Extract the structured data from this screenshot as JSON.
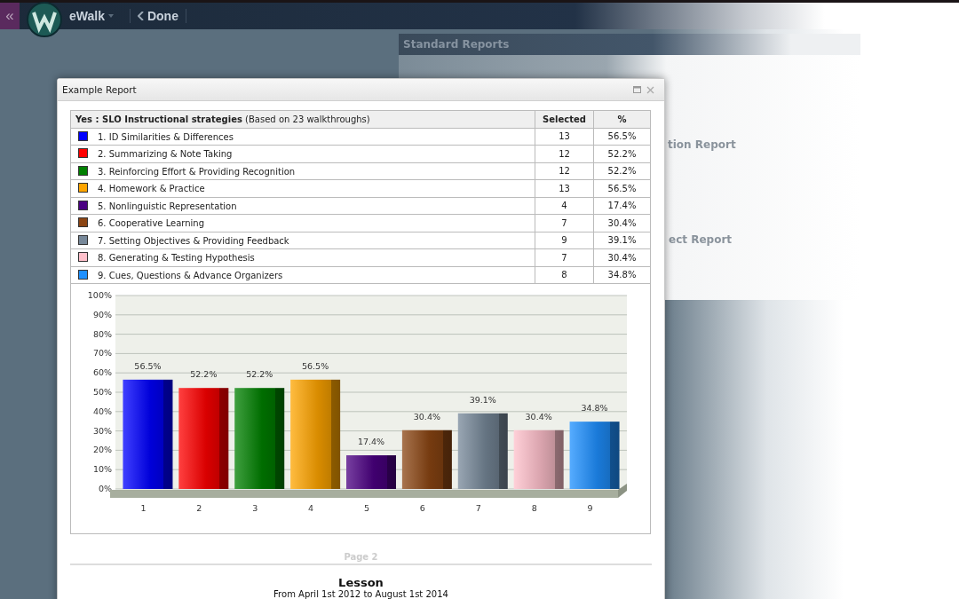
{
  "topbar": {
    "back": "«",
    "app_name": "eWalk",
    "done": "Done"
  },
  "background_panel": {
    "title": "Standard Reports",
    "cards": [
      "tion Report",
      "ect Report"
    ]
  },
  "dialog": {
    "title": "Example Report",
    "table": {
      "heading_bold": "Yes : SLO Instructional strategies",
      "heading_note": "(Based on 23 walkthroughs)",
      "columns": [
        "Selected",
        "%"
      ],
      "rows": [
        {
          "label": "1. ID Similarities & Differences",
          "color": "#0000ff",
          "selected": "13",
          "percent": "56.5%"
        },
        {
          "label": "2. Summarizing & Note Taking",
          "color": "#ff0000",
          "selected": "12",
          "percent": "52.2%"
        },
        {
          "label": "3. Reinforcing Effort & Providing Recognition",
          "color": "#008000",
          "selected": "12",
          "percent": "52.2%"
        },
        {
          "label": "4. Homework & Practice",
          "color": "#ffa500",
          "selected": "13",
          "percent": "56.5%"
        },
        {
          "label": "5. Nonlinguistic Representation",
          "color": "#4b0082",
          "selected": "4",
          "percent": "17.4%"
        },
        {
          "label": "6. Cooperative Learning",
          "color": "#8b4513",
          "selected": "7",
          "percent": "30.4%"
        },
        {
          "label": "7. Setting Objectives & Providing Feedback",
          "color": "#778899",
          "selected": "9",
          "percent": "39.1%"
        },
        {
          "label": "8. Generating & Testing Hypothesis",
          "color": "#ffc0cb",
          "selected": "7",
          "percent": "30.4%"
        },
        {
          "label": "9. Cues, Questions & Advance Organizers",
          "color": "#1e90ff",
          "selected": "8",
          "percent": "34.8%"
        }
      ]
    },
    "chart_data": {
      "type": "bar",
      "categories": [
        "1",
        "2",
        "3",
        "4",
        "5",
        "6",
        "7",
        "8",
        "9"
      ],
      "grid": true,
      "series": [
        {
          "values": [
            56.5,
            52.2,
            52.2,
            56.5,
            17.4,
            30.4,
            39.1,
            30.4,
            34.8
          ]
        }
      ],
      "ylim": [
        0,
        100
      ],
      "yticks": [
        {
          "value": 0,
          "label": "0%"
        },
        {
          "value": 10,
          "label": "10%"
        },
        {
          "value": 20,
          "label": "20%"
        },
        {
          "value": 30,
          "label": "30%"
        },
        {
          "value": 40,
          "label": "40%"
        },
        {
          "value": 50,
          "label": "50%"
        },
        {
          "value": 60,
          "label": "60%"
        },
        {
          "value": 70,
          "label": "70%"
        },
        {
          "value": 80,
          "label": "80%"
        },
        {
          "value": 90,
          "label": "90%"
        },
        {
          "value": 100,
          "label": "100%"
        }
      ],
      "value_labels": [
        "56.5%",
        "52.2%",
        "52.2%",
        "56.5%",
        "17.4%",
        "30.4%",
        "39.1%",
        "30.4%",
        "34.8%"
      ]
    },
    "page_label": "Page 2",
    "section_title": "Lesson",
    "section_range": "From April 1st 2012 to August 1st 2014"
  }
}
